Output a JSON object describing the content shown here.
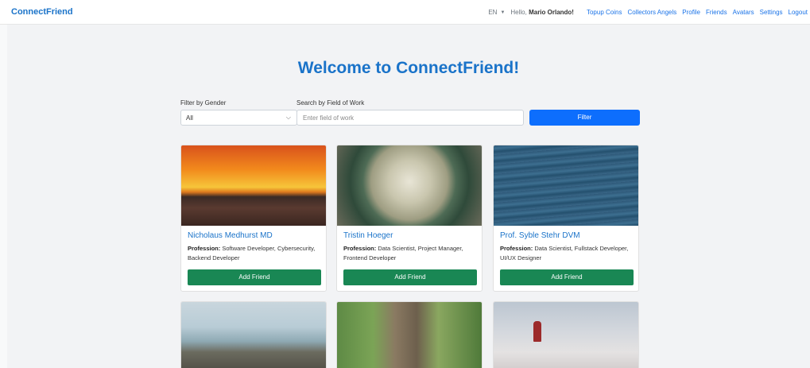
{
  "navbar": {
    "brand": "ConnectFriend",
    "language": "EN",
    "greeting_prefix": "Hello,",
    "user_name": "Mario Orlando!",
    "links": [
      "Topup Coins",
      "Collectors Angels",
      "Profile",
      "Friends",
      "Avatars",
      "Settings",
      "Logout"
    ]
  },
  "main": {
    "title": "Welcome to ConnectFriend!",
    "filters": {
      "gender_label": "Filter by Gender",
      "gender_value": "All",
      "work_label": "Search by Field of Work",
      "work_placeholder": "Enter field of work",
      "button_label": "Filter"
    }
  },
  "cards": [
    {
      "name": "Nicholaus Medhurst MD",
      "profession_label": "Profession:",
      "profession": "Software Developer, Cybersecurity, Backend Developer",
      "button": "Add Friend",
      "image": "sunset-photo"
    },
    {
      "name": "Tristin Hoeger",
      "profession_label": "Profession:",
      "profession": "Data Scientist, Project Manager, Frontend Developer",
      "button": "Add Friend",
      "image": "cactus-photo"
    },
    {
      "name": "Prof. Syble Stehr DVM",
      "profession_label": "Profession:",
      "profession": "Data Scientist, Fullstack Developer, UI/UX Designer",
      "button": "Add Friend",
      "image": "ocean-photo"
    },
    {
      "image": "lake-rocks-photo"
    },
    {
      "image": "forest-path-photo"
    },
    {
      "image": "snowy-person-photo"
    }
  ],
  "colors": {
    "brand": "#1a73c9",
    "primary_button": "#0d6efd",
    "success_button": "#198754"
  }
}
